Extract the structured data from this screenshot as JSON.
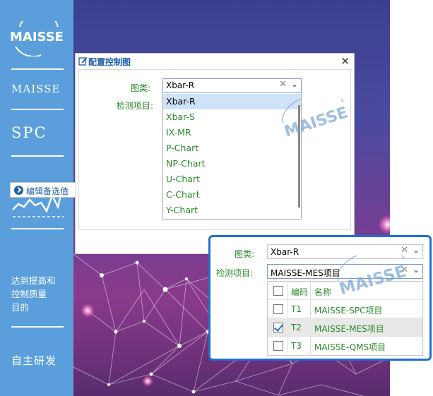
{
  "sidebar": {
    "logo_text": "MAISSE",
    "maisse_label": "MAISSE",
    "spc_label": "SPC",
    "goal_text": [
      "达到提高和",
      "控制质量",
      "目的"
    ],
    "self_dev_label": "自主研发"
  },
  "dialog": {
    "title": "配置控制图",
    "chart_type_label": "图类:",
    "inspection_label": "检测项目:",
    "chart_type_value": "Xbar-R",
    "chart_options": [
      "Xbar-R",
      "Xbar-S",
      "IX-MR",
      "P-Chart",
      "NP-Chart",
      "U-Chart",
      "C-Chart",
      "Y-Chart"
    ],
    "selected_option": "Xbar-R",
    "edit_options_button": "编辑备选值"
  },
  "zoom_panel": {
    "chart_type_label": "图类:",
    "chart_type_value": "Xbar-R",
    "inspection_label": "检测项目:",
    "inspection_value": "MAISSE-MES项目",
    "table_headers": {
      "code": "编码",
      "name": "名称"
    },
    "rows": [
      {
        "code": "T1",
        "name": "MAISSE-SPC项目",
        "checked": false
      },
      {
        "code": "T2",
        "name": "MAISSE-MES项目",
        "checked": true
      },
      {
        "code": "T3",
        "name": "MAISSE-QMS项目",
        "checked": false
      }
    ]
  },
  "watermark_text": "MAISSE",
  "colors": {
    "sidebar_blue": "#5a9fdc",
    "panel_border": "#1f6fd1",
    "label_green": "#2a8a2a",
    "selected_row": "#cfe3f8"
  }
}
